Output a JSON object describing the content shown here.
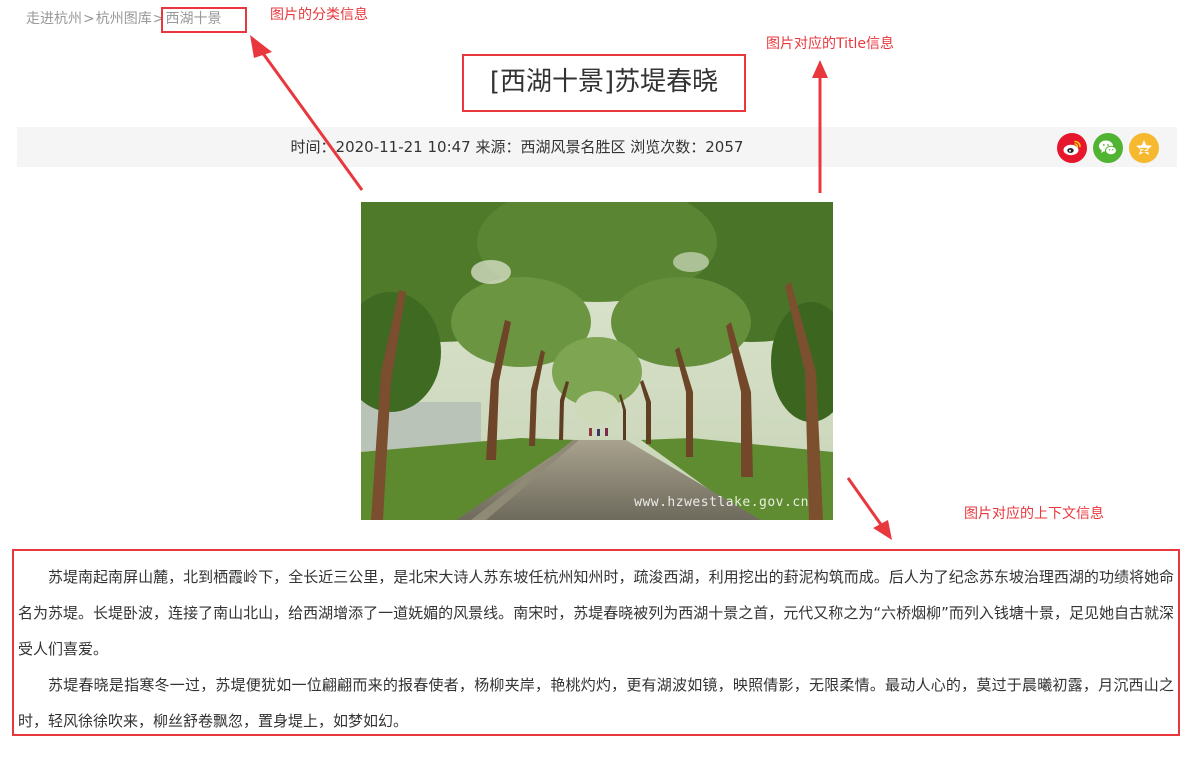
{
  "breadcrumb": {
    "items": [
      "走进杭州",
      "杭州图库"
    ],
    "separator": ">",
    "current": "西湖十景"
  },
  "annotations": {
    "category": "图片的分类信息",
    "title": "图片对应的Title信息",
    "context": "图片对应的上下文信息"
  },
  "article": {
    "title": "[西湖十景]苏堤春晓",
    "meta": "时间：2020-11-21 10:47 来源：西湖风景名胜区 浏览次数：2057",
    "share": {
      "icons": [
        "weibo-icon",
        "wechat-icon",
        "qzone-icon"
      ]
    },
    "image_watermark": "www.hzwestlake.gov.cn",
    "paragraphs": [
      "苏堤南起南屏山麓，北到栖霞岭下，全长近三公里，是北宋大诗人苏东坡任杭州知州时，疏浚西湖，利用挖出的葑泥构筑而成。后人为了纪念苏东坡治理西湖的功绩将她命名为苏堤。长堤卧波，连接了南山北山，给西湖增添了一道妩媚的风景线。南宋时，苏堤春晓被列为西湖十景之首，元代又称之为“六桥烟柳”而列入钱塘十景，足见她自古就深受人们喜爱。",
      "苏堤春晓是指寒冬一过，苏堤便犹如一位翩翩而来的报春使者，杨柳夹岸，艳桃灼灼，更有湖波如镜，映照倩影，无限柔情。最动人心的，莫过于晨曦初露，月沉西山之时，轻风徐徐吹来，柳丝舒卷飘忽，置身堤上，如梦如幻。"
    ]
  },
  "colors": {
    "annotation": "#e8383d",
    "meta_bg": "#f5f5f5",
    "weibo": "#e6162d",
    "wechat": "#51b332",
    "qzone": "#f5b82e"
  }
}
